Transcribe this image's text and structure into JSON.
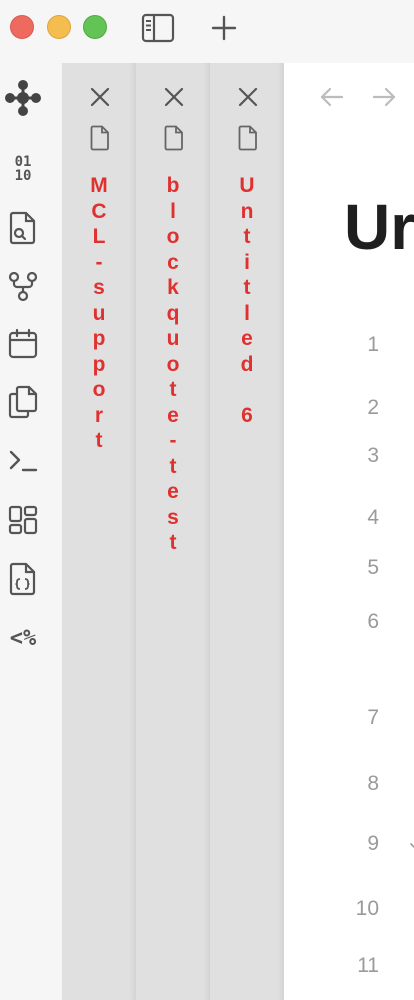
{
  "window": {
    "traffic_lights": [
      "close",
      "minimize",
      "zoom"
    ],
    "toolbar": [
      {
        "name": "sidebar-toggle",
        "icon": "sidebar-icon"
      },
      {
        "name": "new-tab",
        "icon": "plus-icon"
      }
    ]
  },
  "ribbon": {
    "items": [
      {
        "name": "graph-view",
        "icon": "graph-nodes-icon"
      },
      {
        "name": "binary",
        "icon": "binary-icon",
        "text_top": "01",
        "text_bottom": "10"
      },
      {
        "name": "search-file",
        "icon": "file-search-icon"
      },
      {
        "name": "git",
        "icon": "git-fork-icon"
      },
      {
        "name": "calendar",
        "icon": "calendar-icon"
      },
      {
        "name": "copy",
        "icon": "copy-files-icon"
      },
      {
        "name": "terminal",
        "icon": "terminal-icon"
      },
      {
        "name": "dashboard",
        "icon": "dashboard-icon"
      },
      {
        "name": "json-file",
        "icon": "code-file-icon"
      },
      {
        "name": "templater",
        "icon": "templater-icon",
        "text": "<%"
      }
    ]
  },
  "tabs": [
    {
      "title": "MCL-support",
      "close_icon": "close-icon",
      "file_icon": "file-icon"
    },
    {
      "title": "blockquote-test",
      "close_icon": "close-icon",
      "file_icon": "file-icon"
    },
    {
      "title": "Untitled 6",
      "close_icon": "close-icon",
      "file_icon": "file-icon"
    }
  ],
  "editor": {
    "nav": {
      "back_icon": "arrow-left-icon",
      "forward_icon": "arrow-right-icon"
    },
    "title": "Ur",
    "line_numbers": [
      "1",
      "2",
      "3",
      "4",
      "5",
      "6",
      "7",
      "8",
      "9",
      "10",
      "11"
    ]
  },
  "colors": {
    "tab_title": "#e03131",
    "stack_bg": "#e0e0e0",
    "ribbon_bg": "#f6f6f6",
    "editor_bg": "#ffffff",
    "line_number": "#9a9a9a"
  }
}
